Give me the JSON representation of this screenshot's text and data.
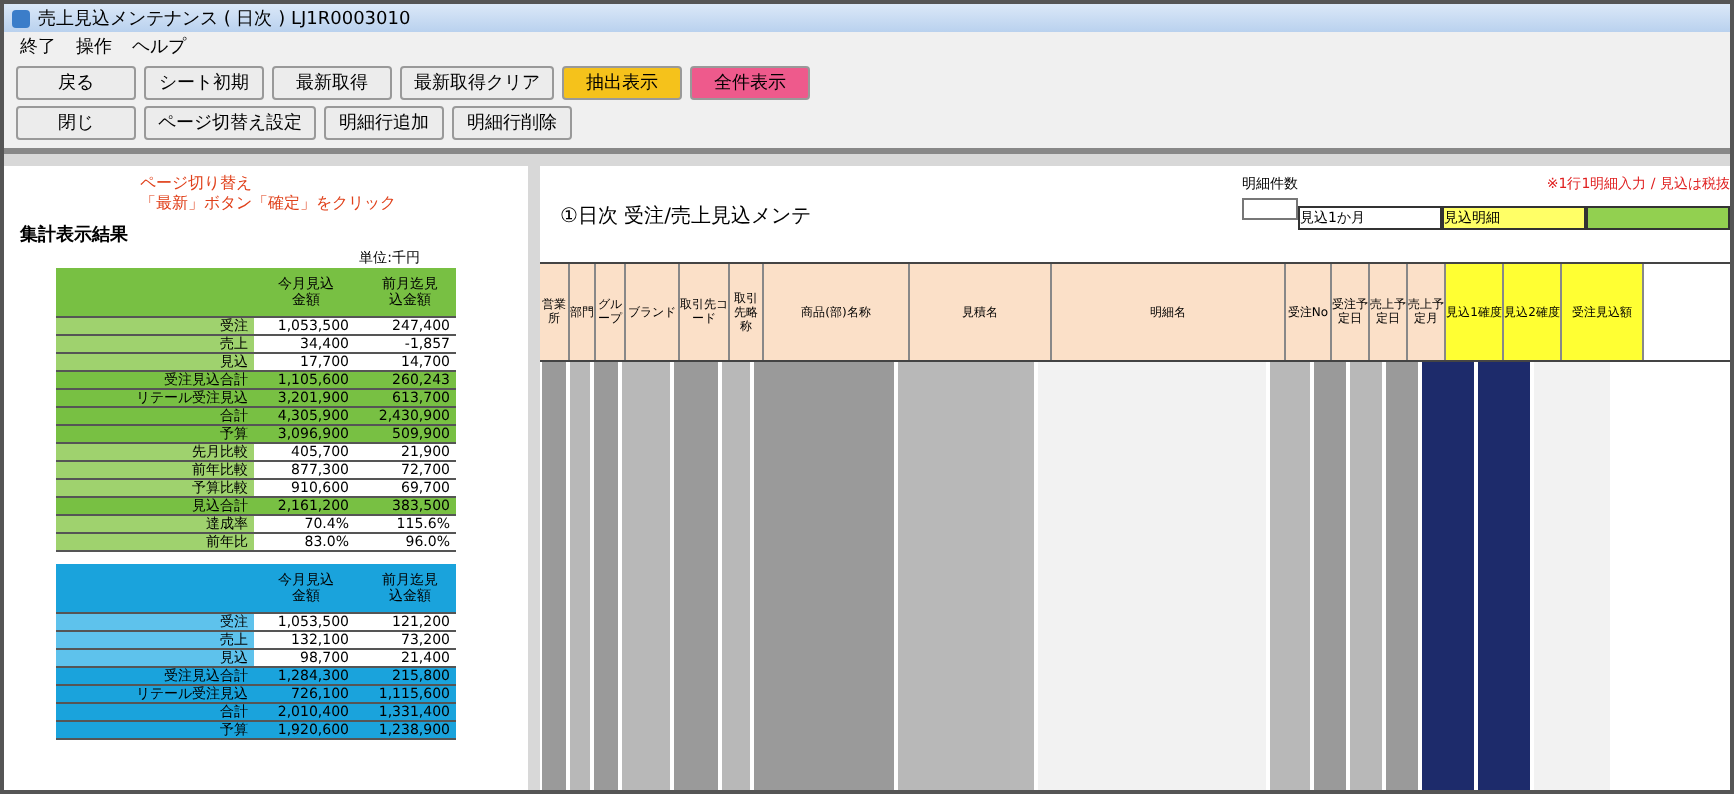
{
  "window": {
    "title": "売上見込メンテナンス ( 日次 )  LJ1R0003010"
  },
  "menu": [
    "終了",
    "操作",
    "ヘルプ"
  ],
  "toolbar": [
    [
      {
        "label": "戻る",
        "color": "#ececec"
      },
      {
        "label": "シート初期",
        "color": "#ececec"
      },
      {
        "label": "最新取得",
        "color": "#ececec"
      },
      {
        "label": "最新取得クリア",
        "color": "#ececec"
      },
      {
        "label": "抽出表示",
        "color": "#f5c21b"
      },
      {
        "label": "全件表示",
        "color": "#ee5a8c"
      }
    ],
    [
      {
        "label": "閉じ",
        "color": "#ececec"
      },
      {
        "label": "ページ切替え設定",
        "color": "#ececec"
      },
      {
        "label": "明細行追加",
        "color": "#ececec"
      },
      {
        "label": "明細行削除",
        "color": "#ececec"
      }
    ]
  ],
  "summary": {
    "notes": [
      "ページ切り替え",
      "「最新」ボタン「確定」をクリック"
    ],
    "heading": "集計表示結果",
    "unit": "単位:千円",
    "tables": [
      {
        "kind": "green",
        "columns": [
          "今月見込金額",
          "前月迄見込金額"
        ],
        "rows": [
          {
            "kind": "plain",
            "label": "受注",
            "values": [
              "1,053,500",
              "247,400"
            ]
          },
          {
            "kind": "plain",
            "label": "売上",
            "values": [
              "34,400",
              "-1,857"
            ]
          },
          {
            "kind": "plain",
            "label": "見込",
            "values": [
              "17,700",
              "14,700"
            ]
          },
          {
            "kind": "band",
            "label": "受注見込合計",
            "values": [
              "1,105,600",
              "260,243"
            ]
          },
          {
            "kind": "band",
            "label": "リテール受注見込",
            "values": [
              "3,201,900",
              "613,700"
            ]
          },
          {
            "kind": "band",
            "label": "合計",
            "values": [
              "4,305,900",
              "2,430,900"
            ]
          },
          {
            "kind": "band",
            "label": "予算",
            "values": [
              "3,096,900",
              "509,900"
            ]
          },
          {
            "kind": "plain",
            "label": "先月比較",
            "values": [
              "405,700",
              "21,900"
            ]
          },
          {
            "kind": "plain",
            "label": "前年比較",
            "values": [
              "877,300",
              "72,700"
            ]
          },
          {
            "kind": "plain",
            "label": "予算比較",
            "values": [
              "910,600",
              "69,700"
            ]
          },
          {
            "kind": "band",
            "label": "見込合計",
            "values": [
              "2,161,200",
              "383,500"
            ]
          },
          {
            "kind": "plain",
            "label": "達成率",
            "values": [
              "70.4%",
              "115.6%"
            ]
          },
          {
            "kind": "plain",
            "label": "前年比",
            "values": [
              "83.0%",
              "96.0%"
            ]
          }
        ]
      },
      {
        "kind": "blue",
        "columns": [
          "今月見込金額",
          "前月迄見込金額"
        ],
        "rows": [
          {
            "kind": "plain",
            "label": "受注",
            "values": [
              "1,053,500",
              "121,200"
            ]
          },
          {
            "kind": "plain",
            "label": "売上",
            "values": [
              "132,100",
              "73,200"
            ]
          },
          {
            "kind": "plain",
            "label": "見込",
            "values": [
              "98,700",
              "21,400"
            ]
          },
          {
            "kind": "band",
            "label": "受注見込合計",
            "values": [
              "1,284,300",
              "215,800"
            ]
          },
          {
            "kind": "band",
            "label": "リテール受注見込",
            "values": [
              "726,100",
              "1,115,600"
            ]
          },
          {
            "kind": "band",
            "label": "合計",
            "values": [
              "2,010,400",
              "1,331,400"
            ]
          },
          {
            "kind": "band",
            "label": "予算",
            "values": [
              "1,920,600",
              "1,238,900"
            ]
          }
        ]
      }
    ]
  },
  "sheet": {
    "title": "①日次 受注/売上見込メンテ",
    "side_label": "明細件数",
    "notice": "※1行1明細入力 / 見込は税抜",
    "group_labels": [
      {
        "label": "見込1か月",
        "color": "#ffffff"
      },
      {
        "label": "見込明細",
        "color": "#ffff66"
      },
      {
        "color": "#92d050"
      }
    ],
    "columns": [
      {
        "label": "営業所",
        "kind": "peach"
      },
      {
        "label": "部門",
        "kind": "peach"
      },
      {
        "label": "グループ",
        "kind": "peach"
      },
      {
        "label": "ブランド",
        "kind": "peach"
      },
      {
        "label": "取引先コード",
        "kind": "peach"
      },
      {
        "label": "取引先略称",
        "kind": "peach"
      },
      {
        "label": "商品(部)名称",
        "kind": "peach"
      },
      {
        "label": "見積名",
        "kind": "peach"
      },
      {
        "label": "明細名",
        "kind": "peach"
      },
      {
        "label": "受注No",
        "kind": "peach"
      },
      {
        "label": "受注予定日",
        "kind": "peach"
      },
      {
        "label": "売上予定日",
        "kind": "peach"
      },
      {
        "label": "売上予定月",
        "kind": "peach"
      },
      {
        "label": "見込1確度",
        "kind": "yellow"
      },
      {
        "label": "見込2確度",
        "kind": "yellow"
      },
      {
        "label": "受注見込額",
        "kind": "yellow"
      }
    ]
  }
}
